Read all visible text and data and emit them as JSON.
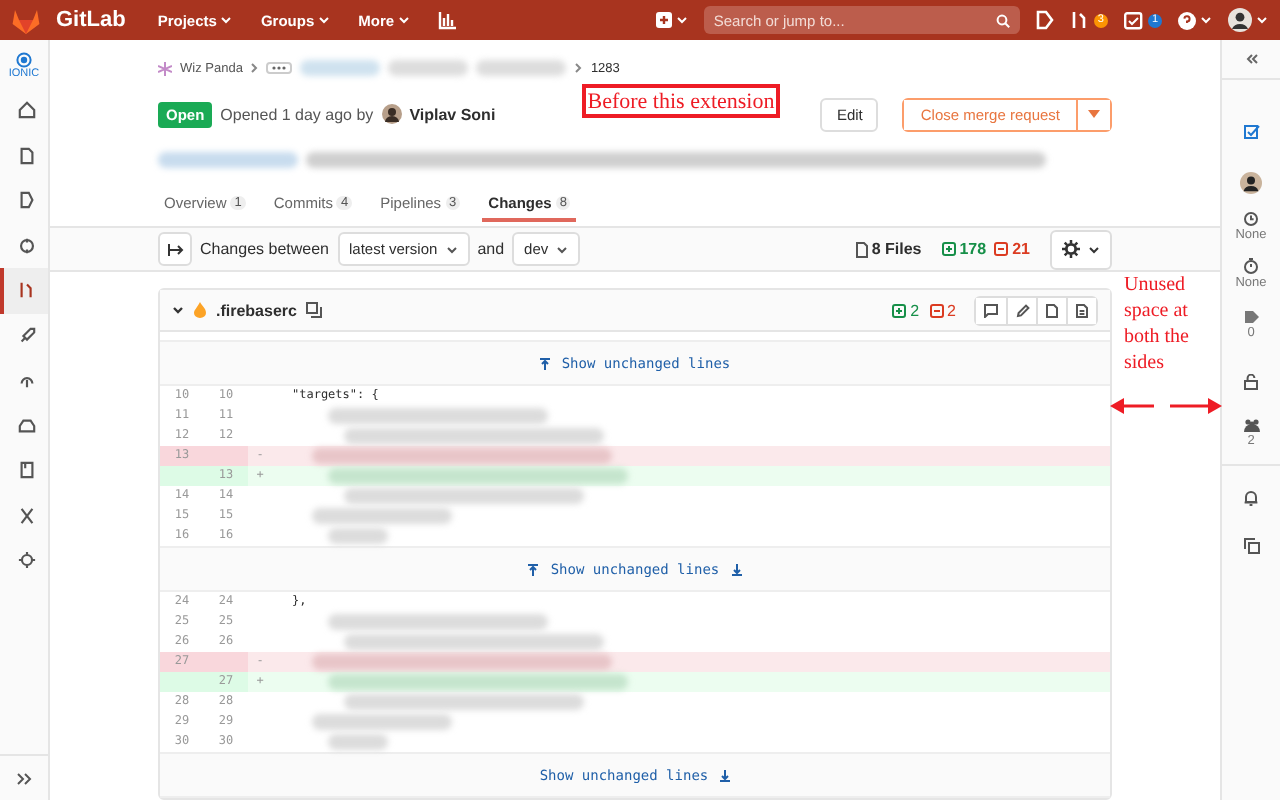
{
  "header": {
    "brand": "GitLab",
    "nav": [
      {
        "label": "Projects"
      },
      {
        "label": "Groups"
      },
      {
        "label": "More"
      }
    ],
    "search": {
      "placeholder": "Search or jump to..."
    },
    "merge_requests_badge": "3",
    "todos_badge": "1"
  },
  "left_sidebar": {
    "project": "IONIC",
    "items": [
      {
        "selected": false
      },
      {
        "selected": false
      },
      {
        "selected": false
      },
      {
        "selected": false
      },
      {
        "selected": true
      },
      {
        "selected": false
      },
      {
        "selected": false
      },
      {
        "selected": false
      },
      {
        "selected": false
      },
      {
        "selected": false
      },
      {
        "selected": false
      }
    ]
  },
  "breadcrumb": {
    "group": "Wiz Panda",
    "current": "1283"
  },
  "merge_request": {
    "status": "Open",
    "opened_text": "Opened 1 day ago by",
    "author": "Viplav Soni",
    "edit_button": "Edit",
    "close_button": "Close merge request"
  },
  "tabs": [
    {
      "label": "Overview",
      "count": "1",
      "selected": false
    },
    {
      "label": "Commits",
      "count": "4",
      "selected": false
    },
    {
      "label": "Pipelines",
      "count": "3",
      "selected": false
    },
    {
      "label": "Changes",
      "count": "8",
      "selected": true
    }
  ],
  "toolbar": {
    "compare_label": "Changes between",
    "source_version": "latest version",
    "and_label": "and",
    "target_branch": "dev",
    "files_count": "8 Files",
    "additions": "178",
    "deletions": "21"
  },
  "diff_file": {
    "name": ".firebaserc",
    "additions": "2",
    "deletions": "2",
    "sections": [
      {
        "kind": "expander",
        "label": "Show unchanged lines",
        "expand_up": true,
        "expand_down": false
      },
      {
        "kind": "lines",
        "lines": [
          {
            "old": "10",
            "new": "10",
            "kind": "context",
            "code": "\"targets\": {"
          },
          {
            "old": "11",
            "new": "11",
            "kind": "context",
            "blurred": true
          },
          {
            "old": "12",
            "new": "12",
            "kind": "context",
            "blurred": true
          },
          {
            "old": "13",
            "kind": "del",
            "marker": "-",
            "blurred": true
          },
          {
            "new": "13",
            "kind": "add",
            "marker": "+",
            "blurred": true
          },
          {
            "old": "14",
            "new": "14",
            "kind": "context",
            "blurred": true
          },
          {
            "old": "15",
            "new": "15",
            "kind": "context",
            "blurred": true
          },
          {
            "old": "16",
            "new": "16",
            "kind": "context",
            "blurred": true
          }
        ]
      },
      {
        "kind": "expander",
        "label": "Show unchanged lines",
        "expand_up": true,
        "expand_down": true
      },
      {
        "kind": "lines",
        "lines": [
          {
            "old": "24",
            "new": "24",
            "kind": "context",
            "code": "},"
          },
          {
            "old": "25",
            "new": "25",
            "kind": "context",
            "blurred": true
          },
          {
            "old": "26",
            "new": "26",
            "kind": "context",
            "blurred": true
          },
          {
            "old": "27",
            "kind": "del",
            "marker": "-",
            "blurred": true
          },
          {
            "new": "27",
            "kind": "add",
            "marker": "+",
            "blurred": true
          },
          {
            "old": "28",
            "new": "28",
            "kind": "context",
            "blurred": true
          },
          {
            "old": "29",
            "new": "29",
            "kind": "context",
            "blurred": true
          },
          {
            "old": "30",
            "new": "30",
            "kind": "context",
            "blurred": true
          }
        ]
      },
      {
        "kind": "expander",
        "label": "Show unchanged lines",
        "expand_up": false,
        "expand_down": true
      }
    ]
  },
  "right_sidebar": {
    "time_estimate": "None",
    "time_spent": "None",
    "labels_count": "0",
    "participants_count": "2"
  },
  "annotations": {
    "box_label": "Before this extension",
    "side_note": "Unused space at both the sides"
  }
}
